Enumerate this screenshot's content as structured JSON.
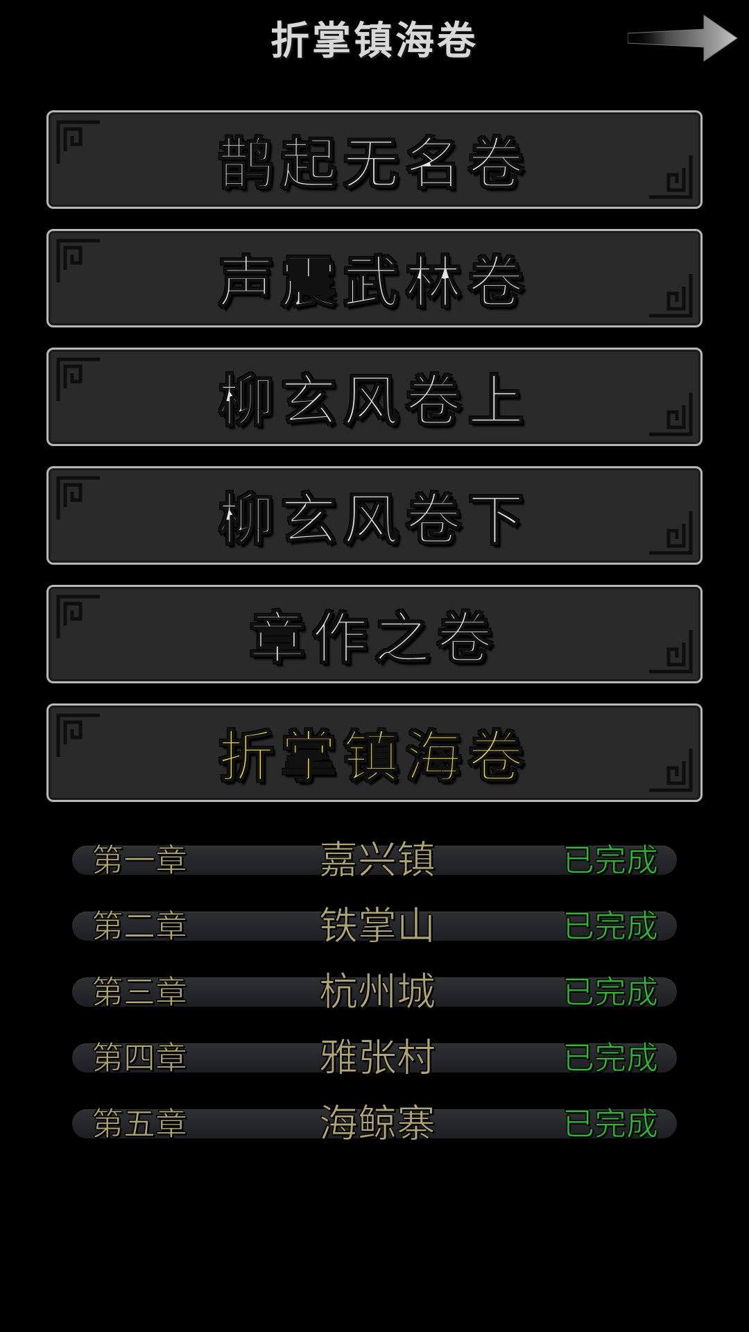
{
  "header": {
    "title": "折掌镇海卷",
    "next_icon": "right-arrow-icon"
  },
  "volumes": [
    {
      "label": "鹊起无名卷",
      "active": false
    },
    {
      "label": "声震武林卷",
      "active": false
    },
    {
      "label": "柳玄风卷上",
      "active": false
    },
    {
      "label": "柳玄风卷下",
      "active": false
    },
    {
      "label": "章作之卷",
      "active": false
    },
    {
      "label": "折掌镇海卷",
      "active": true
    }
  ],
  "chapters": [
    {
      "num": "第一章",
      "name": "嘉兴镇",
      "status": "已完成"
    },
    {
      "num": "第二章",
      "name": "铁掌山",
      "status": "已完成"
    },
    {
      "num": "第三章",
      "name": "杭州城",
      "status": "已完成"
    },
    {
      "num": "第四章",
      "name": "雅张村",
      "status": "已完成"
    },
    {
      "num": "第五章",
      "name": "海鲸寨",
      "status": "已完成"
    }
  ],
  "colors": {
    "background": "#000000",
    "volume_text": "#e6e6e6",
    "active_volume_text": "#f5e43a",
    "chapter_text": "#b2a76a",
    "status_done": "#22c12a"
  }
}
